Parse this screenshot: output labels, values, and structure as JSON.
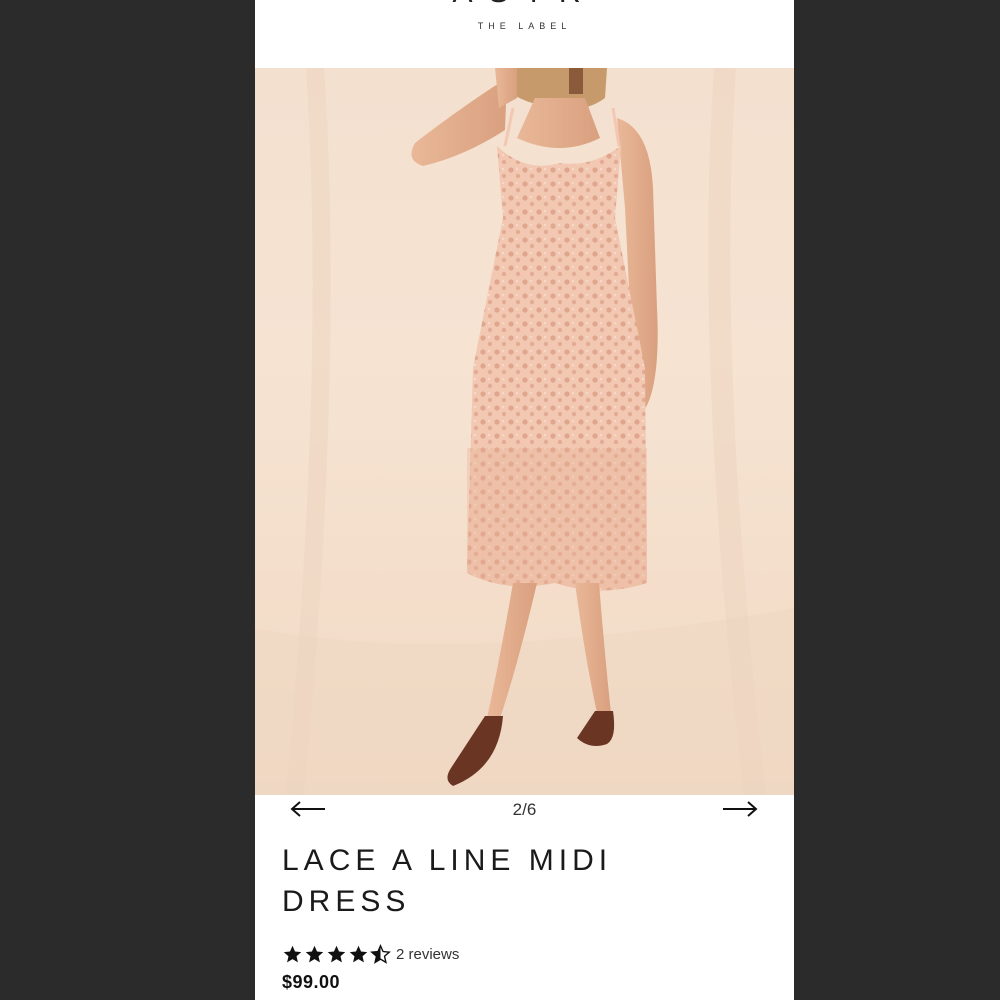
{
  "brand": {
    "logo_text": "ASTR",
    "tagline": "THE LABEL"
  },
  "gallery": {
    "counter": "2/6",
    "prev_icon": "arrow-left-icon",
    "next_icon": "arrow-right-icon",
    "current_index": 2,
    "total": 6
  },
  "product": {
    "title_line1": "LACE A LINE MIDI",
    "title_line2": "DRESS",
    "rating": 4.5,
    "rating_max": 5,
    "reviews_label": "2 reviews",
    "price": "$99.00"
  },
  "colors": {
    "backdrop": "#2b2b2b",
    "dress": "#f0c4ae",
    "background": "#f5e1cf"
  }
}
